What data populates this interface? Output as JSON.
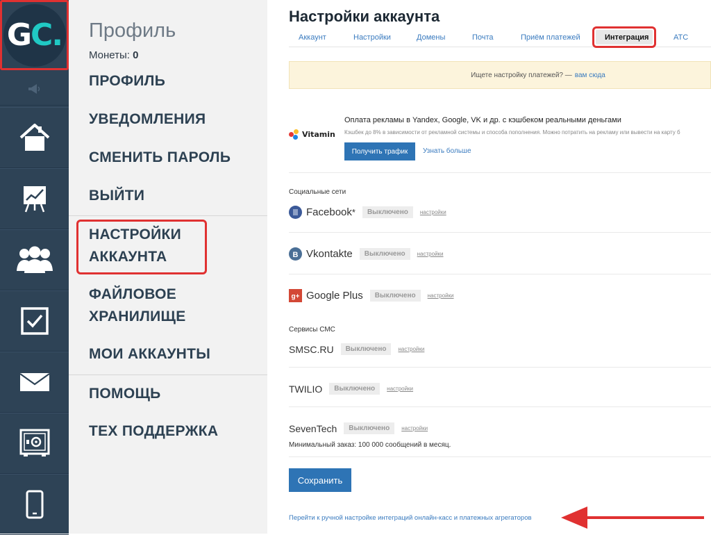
{
  "rail": {
    "logo": {
      "letters": "GC.",
      "colors": {
        "g": "#ffffff",
        "c": "#20c9c4"
      }
    },
    "icons": [
      "megaphone-icon",
      "home-icon",
      "chart-icon",
      "users-icon",
      "checkbox-icon",
      "mail-icon",
      "safe-icon",
      "phone-icon"
    ]
  },
  "menu": {
    "title": "Профиль",
    "coins_label": "Монеты:",
    "coins_value": "0",
    "items": [
      {
        "label": "ПРОФИЛЬ"
      },
      {
        "label": "УВЕДОМЛЕНИЯ"
      },
      {
        "label": "СМЕНИТЬ ПАРОЛЬ"
      },
      {
        "label": "ВЫЙТИ"
      },
      {
        "label_line1": "НАСТРОЙКИ",
        "label_line2": "АККАУНТА"
      },
      {
        "label_line1": "ФАЙЛОВОЕ",
        "label_line2": "ХРАНИЛИЩЕ"
      },
      {
        "label": "МОИ АККАУНТЫ"
      },
      {
        "label": "ПОМОЩЬ"
      },
      {
        "label": "ТЕХ ПОДДЕРЖКА"
      }
    ]
  },
  "main": {
    "title": "Настройки аккаунта",
    "tabs": [
      "Аккаунт",
      "Настройки",
      "Домены",
      "Почта",
      "Приём платежей",
      "Интеграция",
      "АТС"
    ],
    "active_tab": "Интеграция",
    "banner": {
      "text": "Ищете настройку платежей? —",
      "link": "вам сюда"
    },
    "vitamin": {
      "logo_text": "Vitamin",
      "title": "Оплата рекламы в Yandex, Google, VK и др. с кэшбеком реальными деньгами",
      "description": "Кэшбек до 8% в зависимости от рекламной системы и способа пополнения. Можно потратить на рекламу или вывести на карту б",
      "btn_primary": "Получить трафик",
      "btn_link": "Узнать больше"
    },
    "social_label": "Социальные сети",
    "social": [
      {
        "name": "Facebook",
        "suffix": "*",
        "status": "Выключено",
        "settings": "настройки"
      },
      {
        "name": "Vkontakte",
        "suffix": "",
        "status": "Выключено",
        "settings": "настройки"
      },
      {
        "name": "Google Plus",
        "suffix": "",
        "status": "Выключено",
        "settings": "настройки"
      }
    ],
    "sms_label": "Сервисы СМС",
    "sms": [
      {
        "name": "SMSC.RU",
        "status": "Выключено",
        "settings": "настройки"
      },
      {
        "name": "TWILIO",
        "status": "Выключено",
        "settings": "настройки"
      },
      {
        "name": "SevenTech",
        "status": "Выключено",
        "settings": "настройки"
      }
    ],
    "seventech_note": "Минимальный заказ: 100 000 сообщений в месяц.",
    "save_label": "Сохранить",
    "bottom_link": "Перейти к ручной настройке интеграций онлайн-касс и платежных агрегаторов"
  },
  "colors": {
    "accent": "#2e74b5",
    "highlight": "#e03131",
    "rail": "#2e4356"
  }
}
